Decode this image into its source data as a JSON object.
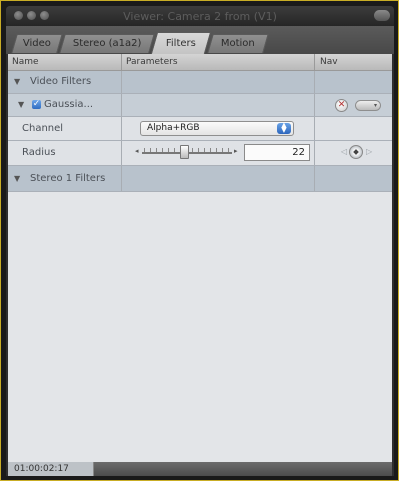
{
  "window": {
    "title": "Viewer: Camera 2 from (V1)"
  },
  "tabs": [
    {
      "label": "Video",
      "active": false
    },
    {
      "label": "Stereo (a1a2)",
      "active": false
    },
    {
      "label": "Filters",
      "active": true
    },
    {
      "label": "Motion",
      "active": false
    }
  ],
  "columns": {
    "name": "Name",
    "parameters": "Parameters",
    "nav": "Nav"
  },
  "rows": {
    "video_filters": "Video Filters",
    "gaussian": "Gaussia...",
    "channel_label": "Channel",
    "channel_value": "Alpha+RGB",
    "radius_label": "Radius",
    "radius_value": "22",
    "stereo_filters": "Stereo 1 Filters"
  },
  "status": {
    "timecode": "01:00:02:17"
  },
  "colors": {
    "frame_border": "#c9ad25",
    "checkbox": "#2e6cc2",
    "reset": "#b23030"
  }
}
